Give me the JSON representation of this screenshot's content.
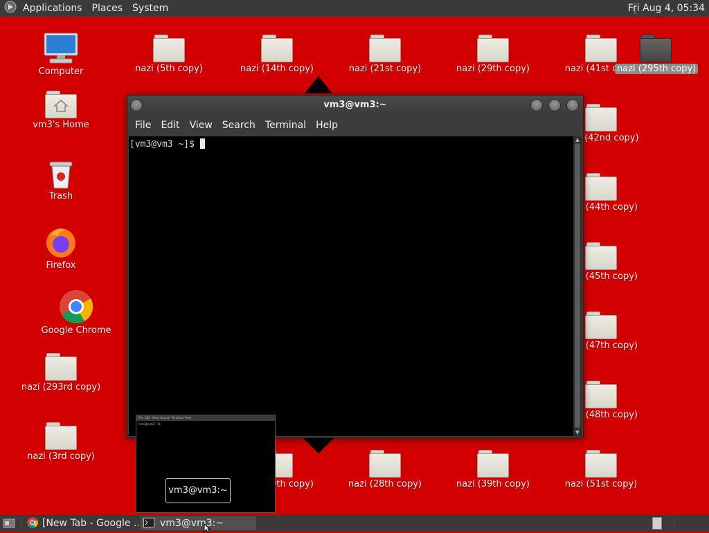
{
  "top_panel": {
    "menus": [
      "Applications",
      "Places",
      "System"
    ],
    "clock": "Fri Aug  4, 05:34"
  },
  "desktop_left": [
    {
      "label": "Computer",
      "icon": "computer-icon"
    },
    {
      "label": "vm3's Home",
      "icon": "home-folder-icon"
    },
    {
      "label": "Trash",
      "icon": "trash-icon"
    },
    {
      "label": "Firefox",
      "icon": "firefox-icon"
    },
    {
      "label": "Google Chrome",
      "icon": "chrome-icon"
    },
    {
      "label": "nazi (293rd copy)",
      "icon": "folder-icon"
    },
    {
      "label": "nazi (3rd copy)",
      "icon": "folder-icon"
    }
  ],
  "desktop_top_row": [
    "nazi (5th copy)",
    "nazi (14th copy)",
    "nazi (21st copy)",
    "nazi (29th copy)",
    "nazi (41st copy)",
    "nazi (295th copy)"
  ],
  "desktop_right_col": [
    "nazi (42nd copy)",
    "nazi (44th copy)",
    "nazi (45th copy)",
    "nazi (47th copy)",
    "nazi (48th copy)"
  ],
  "desktop_bottom_row": [
    "nazi (20th copy)",
    "nazi (28th copy)",
    "nazi (39th copy)",
    "nazi (51st copy)"
  ],
  "terminal": {
    "title": "vm3@vm3:~",
    "menu": [
      "File",
      "Edit",
      "View",
      "Search",
      "Terminal",
      "Help"
    ],
    "prompt": "[vm3@vm3 ~]$ "
  },
  "switcher": {
    "label": "vm3@vm3:~"
  },
  "taskbar": {
    "tasks": [
      "[New Tab - Google ...",
      "vm3@vm3:~"
    ]
  },
  "colors": {
    "wallpaper": "#d20000",
    "panel": "#3a3a3a",
    "terminal_bg": "#000000"
  }
}
